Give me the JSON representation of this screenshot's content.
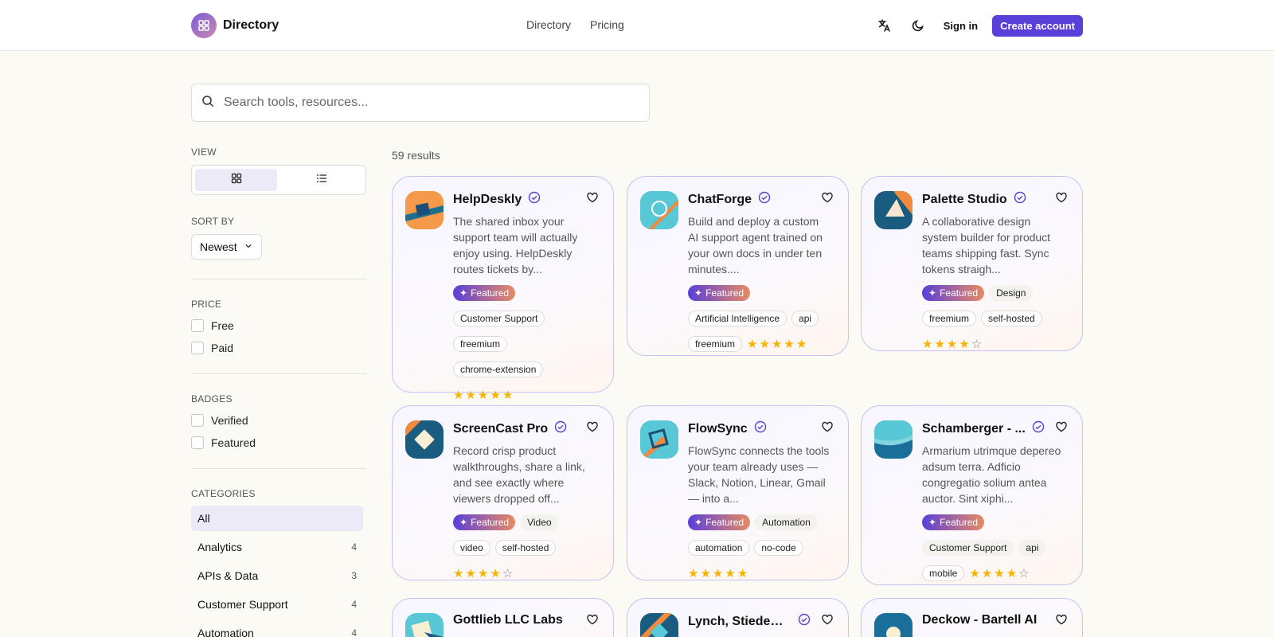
{
  "header": {
    "logo_text": "Directory",
    "nav": [
      "Directory",
      "Pricing"
    ],
    "sign_in": "Sign in",
    "create_account": "Create account"
  },
  "search": {
    "placeholder": "Search tools, resources..."
  },
  "sidebar": {
    "view_label": "VIEW",
    "sort_label": "SORT BY",
    "sort_value": "Newest",
    "price_label": "PRICE",
    "price_options": [
      "Free",
      "Paid"
    ],
    "badges_label": "BADGES",
    "badge_options": [
      "Verified",
      "Featured"
    ],
    "categories_label": "CATEGORIES",
    "categories": [
      {
        "label": "All",
        "count": ""
      },
      {
        "label": "Analytics",
        "count": "4"
      },
      {
        "label": "APIs & Data",
        "count": "3"
      },
      {
        "label": "Customer Support",
        "count": "4"
      },
      {
        "label": "Automation",
        "count": "4"
      }
    ]
  },
  "results_count": "59 results",
  "featured_label": "Featured",
  "cards": [
    {
      "name": "HelpDeskly",
      "desc": "The shared inbox your support team will actually enjoy using. HelpDeskly routes tickets by...",
      "tags": [
        "Customer Support",
        "freemium",
        "chrome-extension"
      ],
      "rating": 5
    },
    {
      "name": "ChatForge",
      "desc": "Build and deploy a custom AI support agent trained on your own docs in under ten minutes....",
      "tags": [
        "Artificial Intelligence",
        "api",
        "freemium"
      ],
      "rating": 5
    },
    {
      "name": "Palette Studio",
      "desc": "A collaborative design system builder for product teams shipping fast. Sync tokens straigh...",
      "tags": [
        "Design",
        "freemium",
        "self-hosted"
      ],
      "rating": 4
    },
    {
      "name": "ScreenCast Pro",
      "desc": "Record crisp product walkthroughs, share a link, and see exactly where viewers dropped off...",
      "tags": [
        "Video",
        "video",
        "self-hosted"
      ],
      "rating": 4
    },
    {
      "name": "FlowSync",
      "desc": "FlowSync connects the tools your team already uses — Slack, Notion, Linear, Gmail — into a...",
      "tags": [
        "Automation",
        "automation",
        "no-code"
      ],
      "rating": 5
    },
    {
      "name": "Schamberger - ...",
      "desc": "Armarium utrimque depereo adsum terra. Adficio congregatio solium antea auctor. Sint xiphi...",
      "tags": [
        "Customer Support",
        "api",
        "mobile"
      ],
      "rating": 4
    },
    {
      "name": "Gottlieb LLC Labs",
      "desc": "",
      "tags": [],
      "rating": 0
    },
    {
      "name": "Lynch, Stiedem...",
      "desc": "",
      "tags": [],
      "rating": 0
    },
    {
      "name": "Deckow - Bartell AI",
      "desc": "",
      "tags": [],
      "rating": 0
    }
  ]
}
